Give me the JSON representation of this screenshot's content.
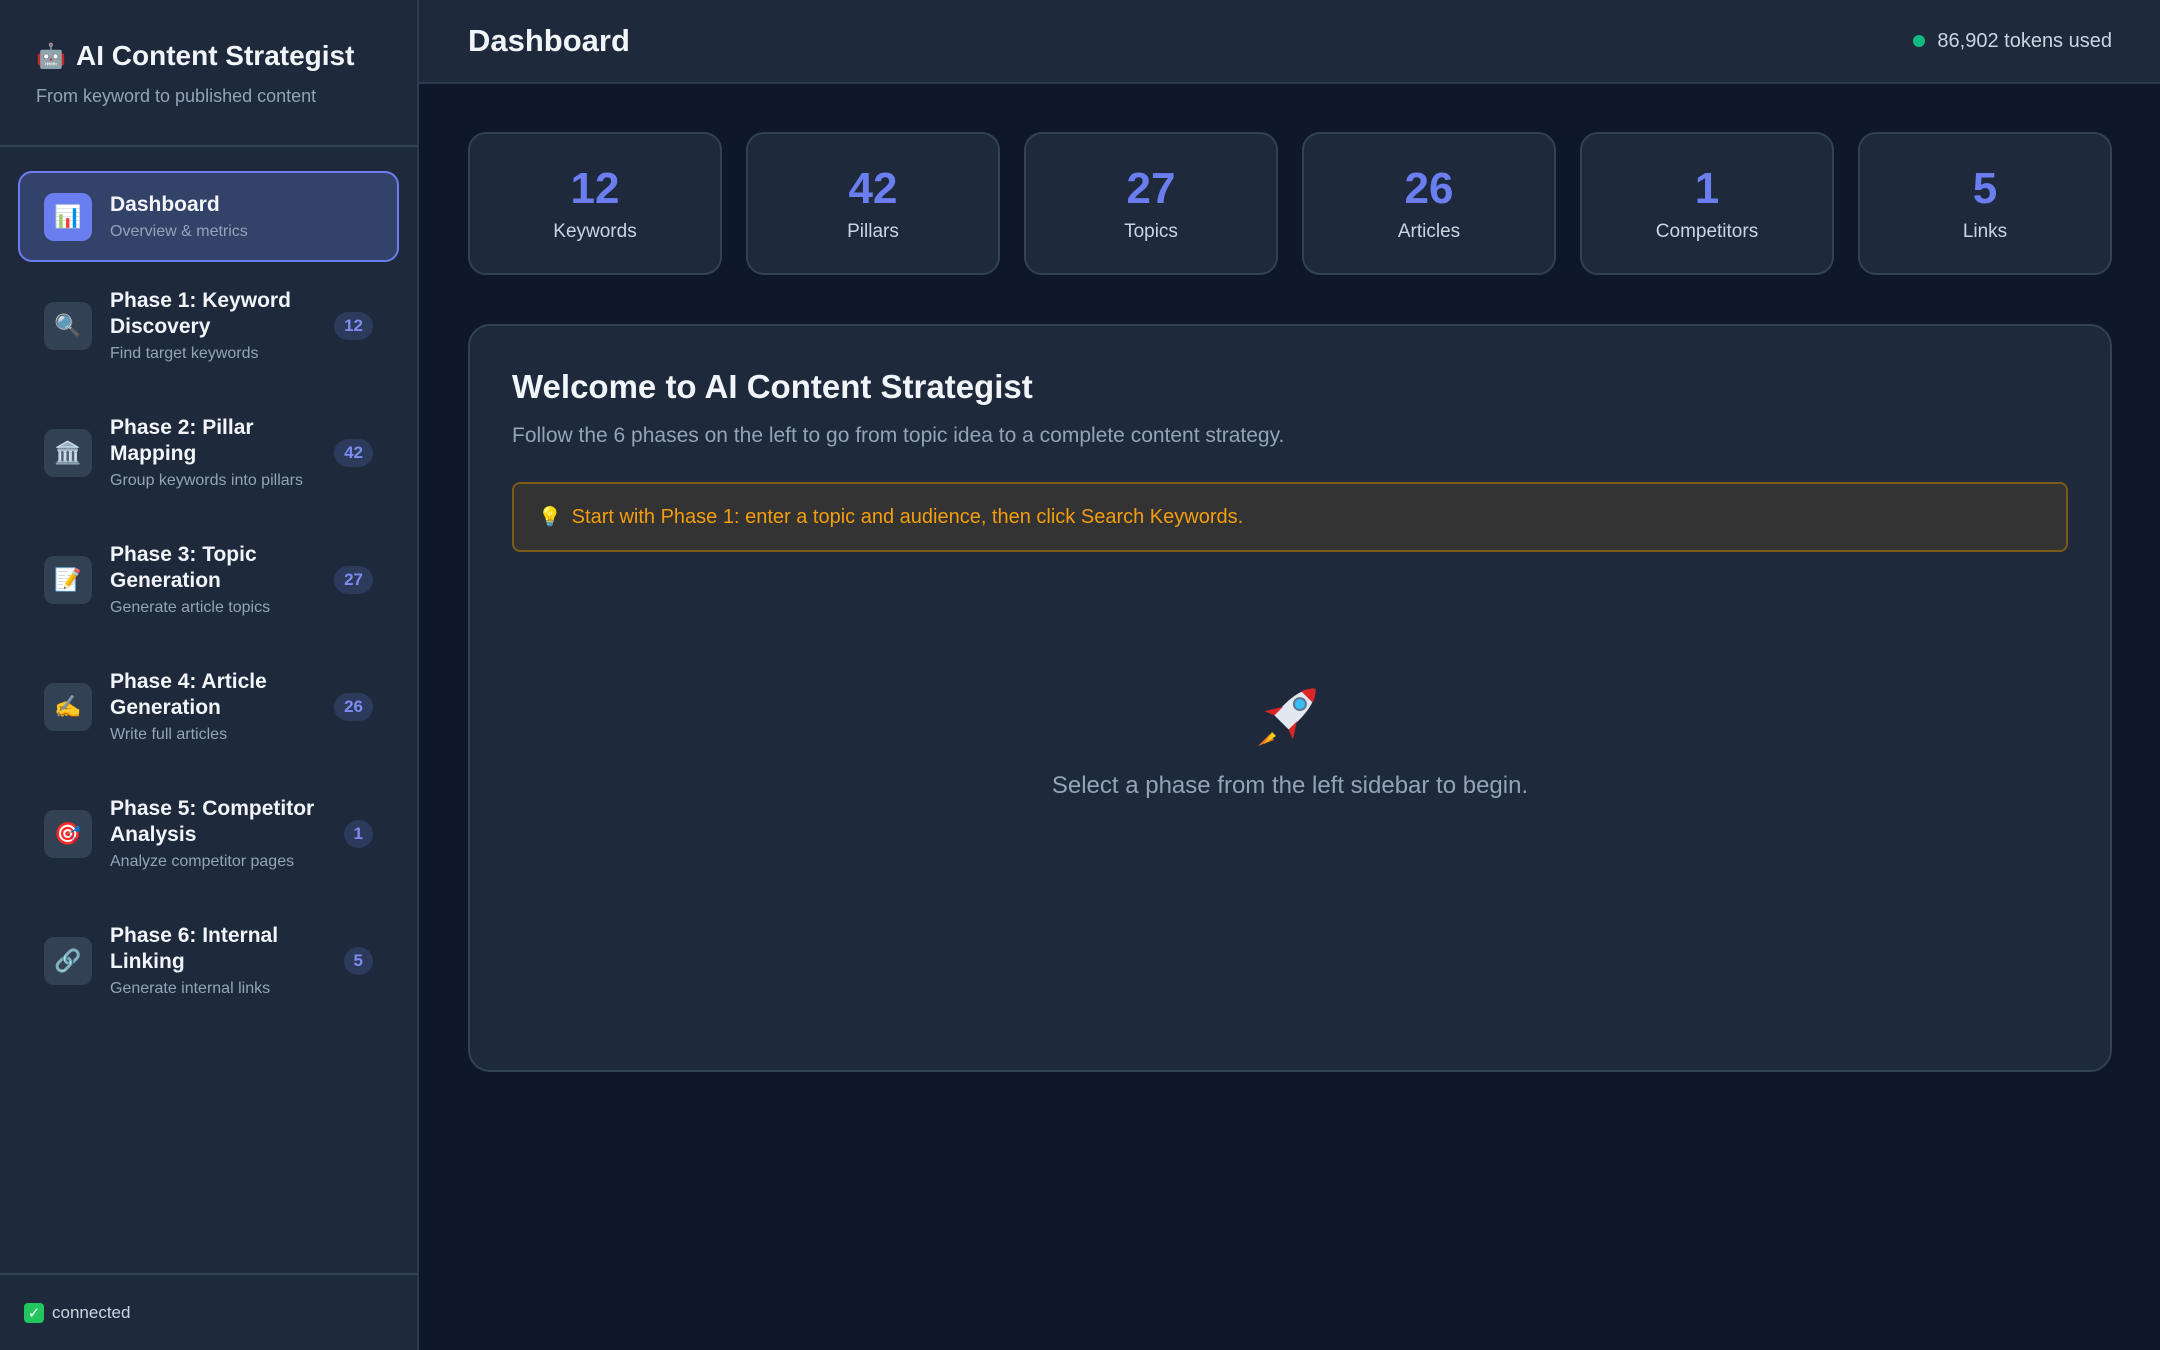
{
  "brand": {
    "title": "AI Content Strategist",
    "subtitle": "From keyword to published content",
    "icon": "robot-icon"
  },
  "sidebar": {
    "items": [
      {
        "title": "Dashboard",
        "desc": "Overview & metrics",
        "badge": "",
        "icon": "bar-chart-icon",
        "glyph": "📊",
        "active": true
      },
      {
        "title": "Phase 1: Keyword Discovery",
        "desc": "Find target keywords",
        "badge": "12",
        "icon": "magnifier-icon",
        "glyph": "🔍"
      },
      {
        "title": "Phase 2: Pillar Mapping",
        "desc": "Group keywords into pillars",
        "badge": "42",
        "icon": "pillar-building-icon",
        "glyph": "🏛️"
      },
      {
        "title": "Phase 3: Topic Generation",
        "desc": "Generate article topics",
        "badge": "27",
        "icon": "memo-icon",
        "glyph": "📝"
      },
      {
        "title": "Phase 4: Article Generation",
        "desc": "Write full articles",
        "badge": "26",
        "icon": "writing-hand-icon",
        "glyph": "✍️"
      },
      {
        "title": "Phase 5: Competitor Analysis",
        "desc": "Analyze competitor pages",
        "badge": "1",
        "icon": "target-icon",
        "glyph": "🎯"
      },
      {
        "title": "Phase 6: Internal Linking",
        "desc": "Generate internal links",
        "badge": "5",
        "icon": "link-icon",
        "glyph": "🔗"
      }
    ],
    "footer_status": "connected"
  },
  "header": {
    "title": "Dashboard",
    "tokens": "86,902 tokens used",
    "status_color": "#10b981"
  },
  "stats": [
    {
      "value": "12",
      "label": "Keywords"
    },
    {
      "value": "42",
      "label": "Pillars"
    },
    {
      "value": "27",
      "label": "Topics"
    },
    {
      "value": "26",
      "label": "Articles"
    },
    {
      "value": "1",
      "label": "Competitors"
    },
    {
      "value": "5",
      "label": "Links"
    }
  ],
  "welcome": {
    "title": "Welcome to AI Content Strategist",
    "subtitle": "Follow the 6 phases on the left to go from topic idea to a complete content strategy.",
    "tip": "Start with Phase 1: enter a topic and audience, then click Search Keywords.",
    "empty_text": "Select a phase from the left sidebar to begin."
  },
  "colors": {
    "accent": "#6b7ef0",
    "background": "#0f172a",
    "panel": "#1e293b",
    "tip_text": "#f59e0b"
  }
}
